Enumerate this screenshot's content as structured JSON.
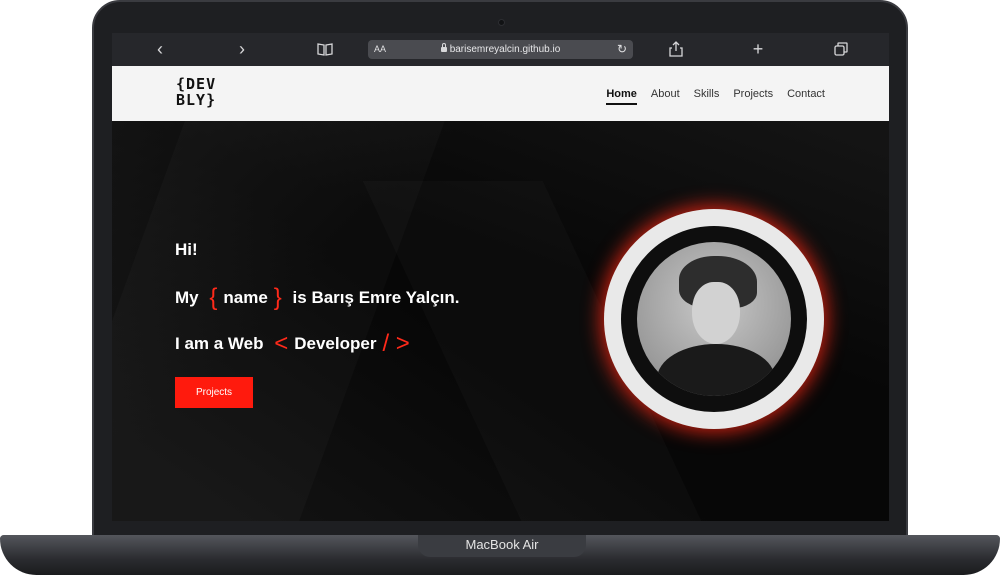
{
  "device": {
    "label": "MacBook Air"
  },
  "browser": {
    "url": "barisemreyalcin.github.io",
    "text_size_label": "AA",
    "icons": [
      "chevron-left-icon",
      "chevron-right-icon",
      "book-icon",
      "lock-icon",
      "reload-icon",
      "share-icon",
      "plus-icon",
      "tabs-icon"
    ]
  },
  "site": {
    "logo": {
      "line1": "{DEV",
      "line2": "BLY}"
    },
    "nav": {
      "items": [
        {
          "label": "Home",
          "active": true
        },
        {
          "label": "About",
          "active": false
        },
        {
          "label": "Skills",
          "active": false
        },
        {
          "label": "Projects",
          "active": false
        },
        {
          "label": "Contact",
          "active": false
        }
      ]
    },
    "hero": {
      "greeting": "Hi!",
      "line2": {
        "prefix": "My",
        "open": "{",
        "word": "name",
        "close": "}",
        "suffix": "is Barış Emre Yalçın."
      },
      "line3": {
        "prefix": "I am a Web",
        "open": "<",
        "word": "Developer",
        "close": "/ >"
      },
      "button_label": "Projects"
    },
    "colors": {
      "accent": "#ff1a0d",
      "nav_bg": "#f4f4f4",
      "hero_bg": "#070707"
    }
  }
}
